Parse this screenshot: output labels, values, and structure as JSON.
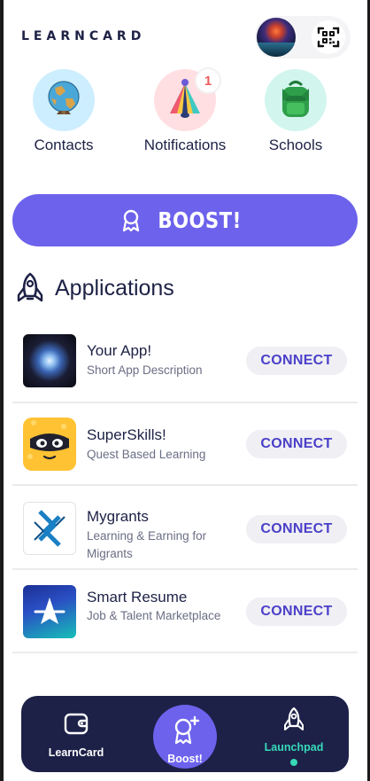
{
  "header": {
    "logo": "LEARNCARD",
    "avatar_icon": "user-avatar",
    "qr_icon": "qr-scan-icon"
  },
  "categories": [
    {
      "label": "Contacts",
      "icon": "globe-icon",
      "bg": "#cdeefe"
    },
    {
      "label": "Notifications",
      "icon": "bell-icon",
      "bg": "#ffdfe2",
      "badge": "1"
    },
    {
      "label": "Schools",
      "icon": "backpack-icon",
      "bg": "#d2f6ee"
    }
  ],
  "boost": {
    "label": "BOOST!",
    "icon": "badge-icon",
    "color": "#6d62ec"
  },
  "applications": {
    "title": "Applications",
    "icon": "rocket-icon",
    "items": [
      {
        "name": "Your App!",
        "description": "Short App Description",
        "action": "CONNECT"
      },
      {
        "name": "SuperSkills!",
        "description": "Quest Based Learning",
        "action": "CONNECT"
      },
      {
        "name": "Mygrants",
        "description": "Learning & Earning for Migrants",
        "action": "CONNECT"
      },
      {
        "name": "Smart Resume",
        "description": "Job & Talent Marketplace",
        "action": "CONNECT"
      }
    ]
  },
  "nav": {
    "learncard": "LearnCard",
    "boost": "Boost!",
    "launchpad": "Launchpad",
    "active": "Launchpad",
    "bg": "#1d2148",
    "accent": "#37d9b8"
  }
}
